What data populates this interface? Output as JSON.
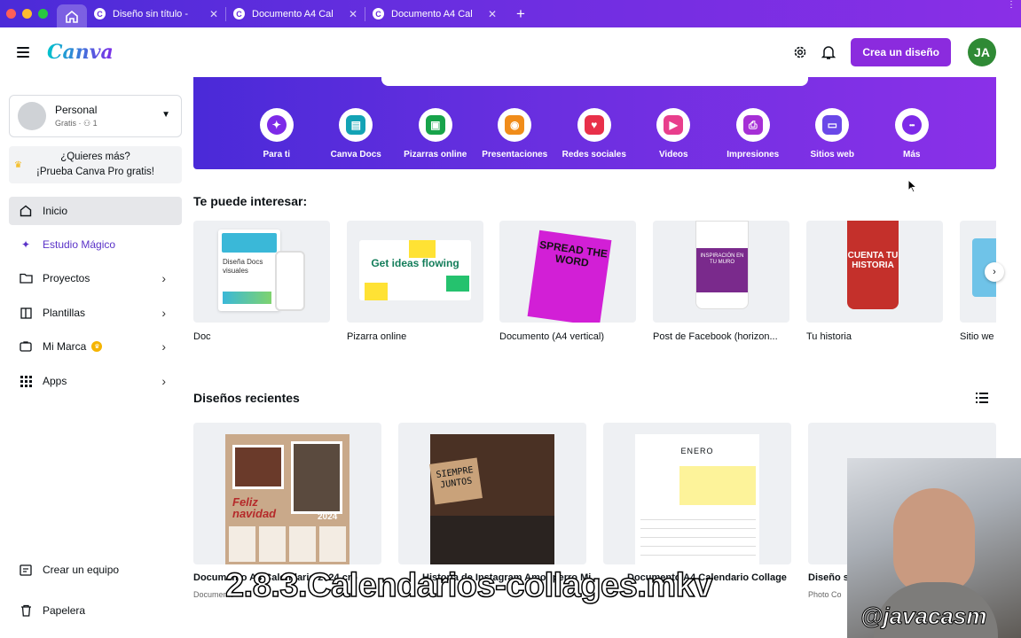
{
  "browser": {
    "tabs": [
      {
        "title": "Diseño sin título -",
        "favicon": "C"
      },
      {
        "title": "Documento A4 Cal",
        "favicon": "C"
      },
      {
        "title": "Documento A4 Cal",
        "favicon": "C"
      }
    ],
    "new_tab": "+"
  },
  "header": {
    "logo": "Canva",
    "create_label": "Crea un diseño",
    "avatar_initials": "JA"
  },
  "sidebar": {
    "account_name": "Personal",
    "account_sub": "Gratis · ⚇ 1",
    "promo_line1": "¿Quieres más?",
    "promo_line2": "¡Prueba Canva Pro gratis!",
    "items": [
      {
        "label": "Inicio",
        "icon": "home-icon"
      },
      {
        "label": "Estudio Mágico",
        "icon": "sparkle-icon"
      },
      {
        "label": "Proyectos",
        "icon": "folder-icon"
      },
      {
        "label": "Plantillas",
        "icon": "template-icon"
      },
      {
        "label": "Mi Marca",
        "icon": "brand-icon"
      },
      {
        "label": "Apps",
        "icon": "apps-grid-icon"
      }
    ],
    "create_team": "Crear un equipo",
    "trash": "Papelera"
  },
  "banner": {
    "categories": [
      {
        "label": "Para ti",
        "color": "#7d2ae8",
        "glyph": "✦"
      },
      {
        "label": "Canva Docs",
        "color": "#13a3b5",
        "glyph": "▤"
      },
      {
        "label": "Pizarras online",
        "color": "#17a34a",
        "glyph": "▣"
      },
      {
        "label": "Presentaciones",
        "color": "#f08c1a",
        "glyph": "◉"
      },
      {
        "label": "Redes sociales",
        "color": "#e8304a",
        "glyph": "♥"
      },
      {
        "label": "Videos",
        "color": "#e83e8c",
        "glyph": "▶"
      },
      {
        "label": "Impresiones",
        "color": "#a52fd6",
        "glyph": "⎙"
      },
      {
        "label": "Sitios web",
        "color": "#6a48e8",
        "glyph": "▭"
      },
      {
        "label": "Más",
        "color": "#7d2ae8",
        "glyph": "•••"
      }
    ]
  },
  "suggestions": {
    "title": "Te puede interesar:",
    "items": [
      {
        "label": "Doc"
      },
      {
        "label": "Pizarra online"
      },
      {
        "label": "Documento (A4 vertical)"
      },
      {
        "label": "Post de Facebook (horizon..."
      },
      {
        "label": "Tu historia"
      },
      {
        "label": "Sitio we"
      }
    ],
    "thumb_texts": {
      "doc": "Diseña Docs visuales",
      "whiteboard": "Get ideas flowing",
      "a4": "SPREAD THE WORD",
      "facebook": "INSPIRACIÓN EN TU MURO",
      "story": "CUENTA TU HISTORIA"
    }
  },
  "recent": {
    "title": "Diseños recientes",
    "items": [
      {
        "title": "Documento A4 Calendario 2024 cro",
        "sub": "Documento"
      },
      {
        "title": "Historia de Instagram Amor perro Mi",
        "sub": "",
        "thumb_text": "SIEMPRE JUNTOS"
      },
      {
        "title": "Documento A4 Calendario Collage",
        "sub": "",
        "thumb_text": "ENERO"
      },
      {
        "title": "Diseño s",
        "sub": "Photo Co"
      }
    ],
    "thumb_texts": {
      "xmas": "Feliz navidad",
      "year": "2024"
    }
  },
  "overlay": {
    "caption": "2.8.3.Calendarios-collages.mkv",
    "watermark": "@javacasm"
  }
}
